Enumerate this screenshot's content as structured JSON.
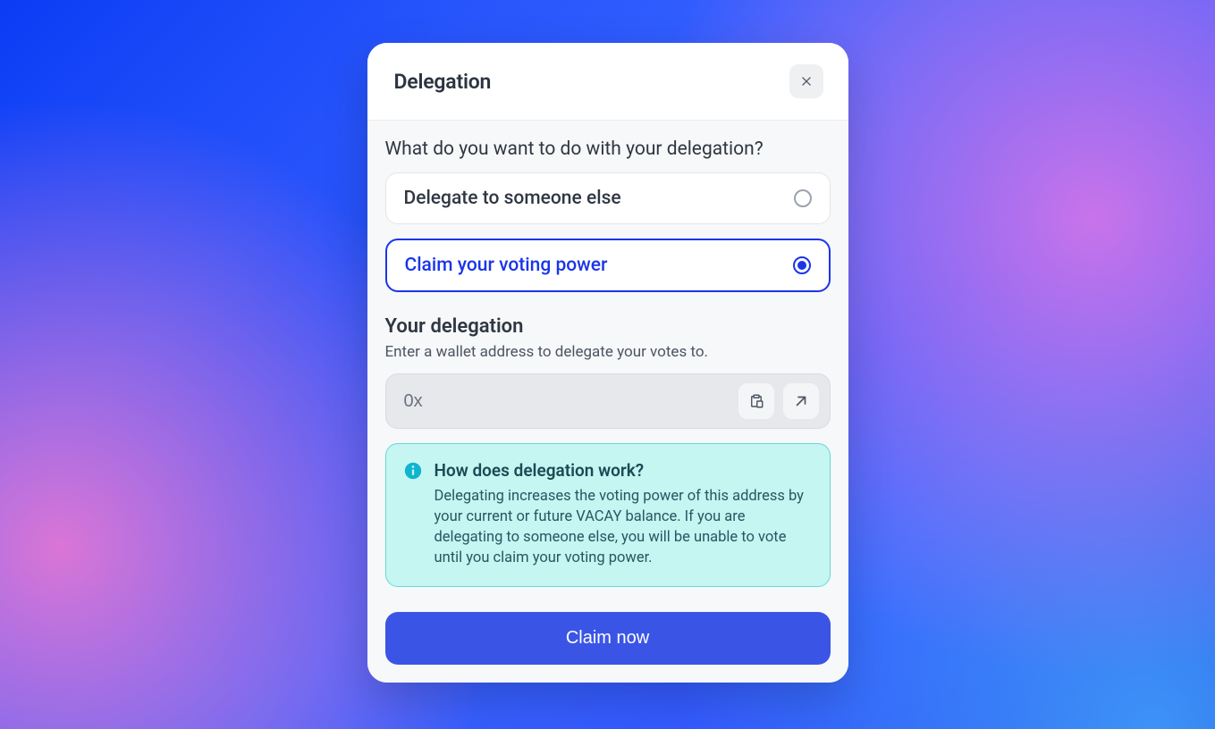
{
  "modal": {
    "title": "Delegation",
    "question": "What do you want to do with your delegation?"
  },
  "options": {
    "delegate": "Delegate to someone else",
    "claim": "Claim your voting power"
  },
  "delegation": {
    "title": "Your delegation",
    "subtitle": "Enter a wallet address to delegate your votes to.",
    "input_value": "0x"
  },
  "info": {
    "title": "How does delegation work?",
    "body": "Delegating increases the voting power of this address by your current or future VACAY balance. If you are delegating to someone else, you will be unable to vote until you claim your voting power."
  },
  "actions": {
    "primary": "Claim now"
  },
  "icons": {
    "close": "close-icon",
    "paste": "paste-icon",
    "external": "arrow-up-right-icon",
    "info": "info-icon"
  },
  "colors": {
    "accent": "#1a35ea",
    "button": "#3a55e6",
    "infoBg": "#c5f6f2",
    "infoBorder": "#66d9d2"
  }
}
